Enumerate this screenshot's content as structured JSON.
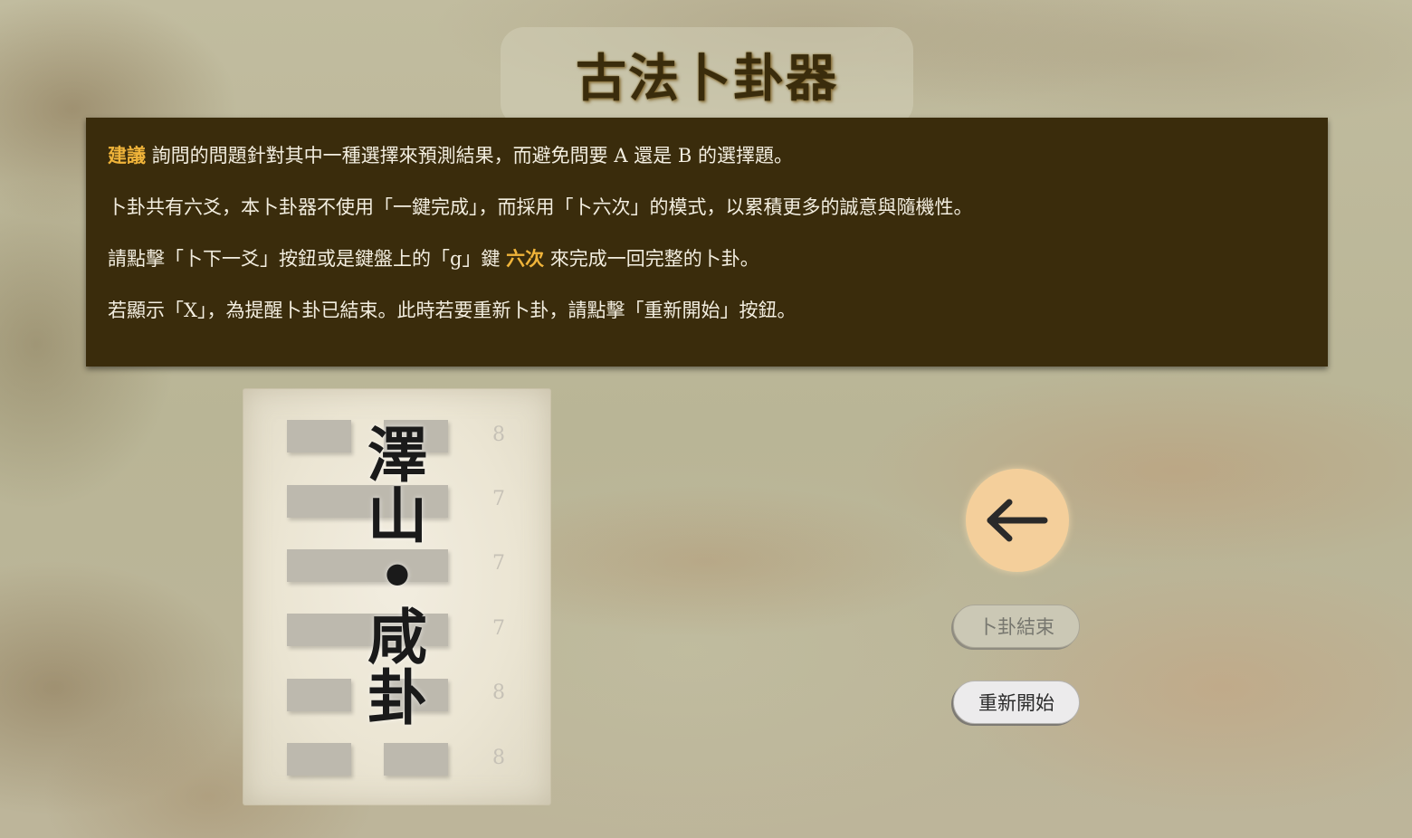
{
  "header": {
    "title": "古法卜卦器"
  },
  "notice": {
    "line1_highlight": "建議",
    "line1_text": " 詢問的問題針對其中一種選擇來預測結果，而避免問要 A 還是 B 的選擇題。",
    "line2_text": "卜卦共有六爻，本卜卦器不使用「一鍵完成」，而採用「卜六次」的模式，以累積更多的誠意與隨機性。",
    "line3_before": "請點擊「卜下一爻」按鈕或是鍵盤上的「g」鍵 ",
    "line3_highlight": "六次",
    "line3_after": " 來完成一回完整的卜卦。",
    "line4_text": "若顯示「X」，為提醒卜卦已結束。此時若要重新卜卦，請點擊「重新開始」按鈕。",
    "highlight_color": "#f0b43a"
  },
  "hexagram": {
    "name_lines": [
      "澤",
      "山",
      "•",
      "咸",
      "卦"
    ],
    "lines": [
      {
        "type": "yin",
        "value": "8"
      },
      {
        "type": "yang",
        "value": "7"
      },
      {
        "type": "yang",
        "value": "7"
      },
      {
        "type": "yang",
        "value": "7"
      },
      {
        "type": "yin",
        "value": "8"
      },
      {
        "type": "yin",
        "value": "8"
      }
    ]
  },
  "controls": {
    "back_icon": "left-arrow-icon",
    "end_label": "卜卦結束",
    "restart_label": "重新開始"
  }
}
